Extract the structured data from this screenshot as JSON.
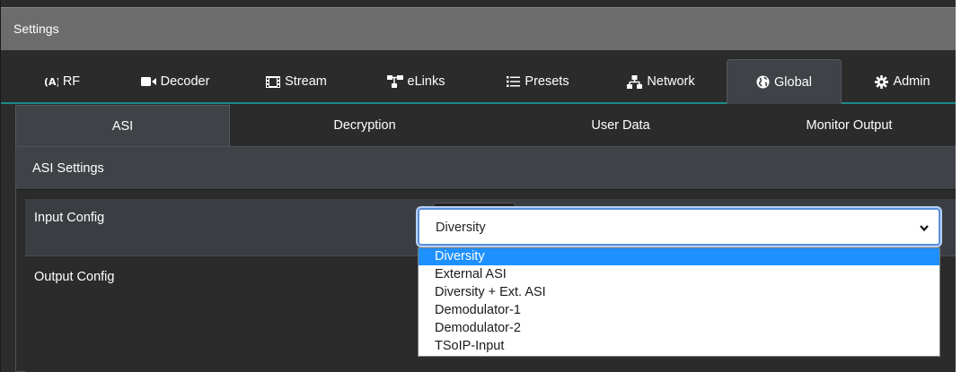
{
  "window": {
    "title": "Settings"
  },
  "tabs": [
    {
      "label": "RF",
      "icon": "antenna-icon"
    },
    {
      "label": "Decoder",
      "icon": "video-camera-icon"
    },
    {
      "label": "Stream",
      "icon": "film-icon"
    },
    {
      "label": "eLinks",
      "icon": "sitemap-icon"
    },
    {
      "label": "Presets",
      "icon": "list-icon"
    },
    {
      "label": "Network",
      "icon": "network-icon"
    },
    {
      "label": "Global",
      "icon": "globe-icon",
      "active": true
    },
    {
      "label": "Admin",
      "icon": "gear-icon"
    }
  ],
  "subtabs": [
    {
      "label": "ASI",
      "active": true
    },
    {
      "label": "Decryption"
    },
    {
      "label": "User Data"
    },
    {
      "label": "Monitor Output"
    }
  ],
  "panel": {
    "title": "ASI Settings",
    "input_config_label": "Input Config",
    "output_config_label": "Output Config",
    "input_config_value": "Diversity",
    "options": [
      "Diversity",
      "External ASI",
      "Diversity + Ext. ASI",
      "Demodulator-1",
      "Demodulator-2",
      "TSoIP-Input"
    ],
    "selected_index": 0
  },
  "colors": {
    "accent": "#1d8a8a",
    "selection": "#1e90ff",
    "focus_border": "#5b8fd9"
  }
}
